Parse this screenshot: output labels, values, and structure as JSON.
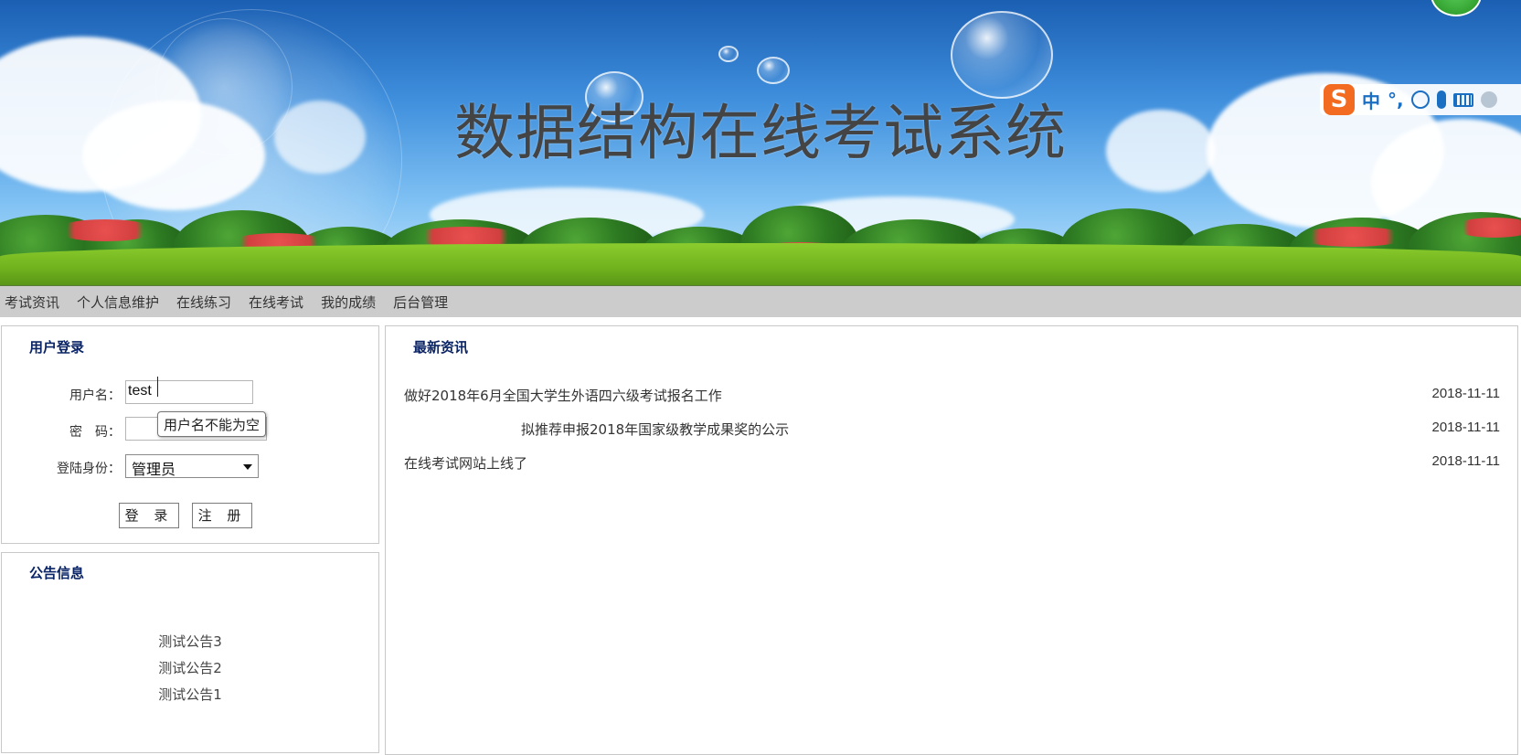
{
  "banner": {
    "title": "数据结构在线考试系统"
  },
  "ime_toolbar": {
    "logo": "S",
    "mode": "中",
    "punct": "°,"
  },
  "nav": {
    "items": [
      "考试资讯",
      "个人信息维护",
      "在线练习",
      "在线考试",
      "我的成绩",
      "后台管理"
    ]
  },
  "login": {
    "title": "用户登录",
    "username_label": "用户名：",
    "username_value": "test",
    "password_label": "密　码：",
    "password_value": "",
    "role_label": "登陆身份：",
    "role_selected": "管理员",
    "tooltip": "用户名不能为空",
    "login_button": "登 录",
    "register_button": "注 册"
  },
  "notices": {
    "title": "公告信息",
    "items": [
      "测试公告3",
      "测试公告2",
      "测试公告1"
    ]
  },
  "news": {
    "title": "最新资讯",
    "items": [
      {
        "title": "做好2018年6月全国大学生外语四六级考试报名工作",
        "date": "2018-11-11"
      },
      {
        "title": "拟推荐申报2018年国家级教学成果奖的公示",
        "date": "2018-11-11"
      },
      {
        "title": "在线考试网站上线了",
        "date": "2018-11-11"
      }
    ]
  },
  "colors": {
    "panel_title": "#0a2465",
    "nav_bg": "#cccccc",
    "ime_accent": "#f36b21"
  }
}
